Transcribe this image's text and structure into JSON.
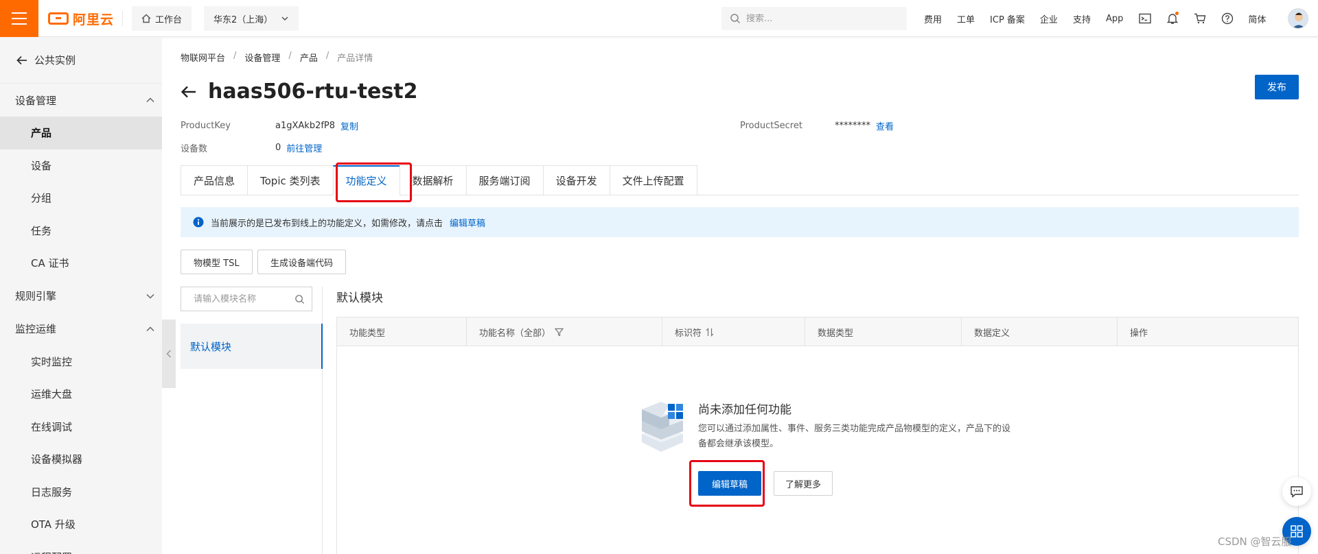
{
  "topbar": {
    "logo_text": "阿里云",
    "workbench": "工作台",
    "region": "华东2（上海）",
    "search_placeholder": "搜索...",
    "links": [
      "费用",
      "工单",
      "ICP 备案",
      "企业",
      "支持",
      "App"
    ],
    "lang": "简体",
    "icons": [
      "terminal-icon",
      "bell-icon",
      "cart-icon",
      "help-icon"
    ],
    "accent_color": "#ff6a00"
  },
  "sidebar": {
    "back_label": "公共实例",
    "groups": [
      {
        "label": "设备管理",
        "expanded": true,
        "items": [
          "产品",
          "设备",
          "分组",
          "任务",
          "CA 证书"
        ]
      },
      {
        "label": "规则引擎",
        "expanded": false,
        "items": []
      },
      {
        "label": "监控运维",
        "expanded": true,
        "items": [
          "实时监控",
          "运维大盘",
          "在线调试",
          "设备模拟器",
          "日志服务",
          "OTA 升级",
          "远程配置"
        ]
      }
    ],
    "active_item": "产品"
  },
  "breadcrumb": [
    "物联网平台",
    "设备管理",
    "产品",
    "产品详情"
  ],
  "page": {
    "title": "haas506-rtu-test2",
    "publish": "发布",
    "product_key_label": "ProductKey",
    "product_key": "a1gXAkb2fP8",
    "copy": "复制",
    "product_secret_label": "ProductSecret",
    "product_secret": "********",
    "view": "查看",
    "device_count_label": "设备数",
    "device_count": "0",
    "manage": "前往管理",
    "primary_color": "#0064c8"
  },
  "tabs": [
    "产品信息",
    "Topic 类列表",
    "功能定义",
    "数据解析",
    "服务端订阅",
    "设备开发",
    "文件上传配置"
  ],
  "active_tab": "功能定义",
  "notice": {
    "text": "当前展示的是已发布到线上的功能定义，如需修改，请点击",
    "link": "编辑草稿"
  },
  "actions": {
    "tsl": "物模型 TSL",
    "gen_code": "生成设备端代码"
  },
  "modules": {
    "search_placeholder": "请输入模块名称",
    "items": [
      "默认模块"
    ],
    "section_title": "默认模块"
  },
  "table": {
    "columns": [
      "功能类型",
      "功能名称（全部）",
      "标识符",
      "数据类型",
      "数据定义",
      "操作"
    ]
  },
  "empty": {
    "title": "尚未添加任何功能",
    "desc": "您可以通过添加属性、事件、服务三类功能完成产品物模型的定义，产品下的设备都会继承该模型。",
    "edit_draft": "编辑草稿",
    "learn_more": "了解更多"
  },
  "watermark": "CSDN @智云服"
}
